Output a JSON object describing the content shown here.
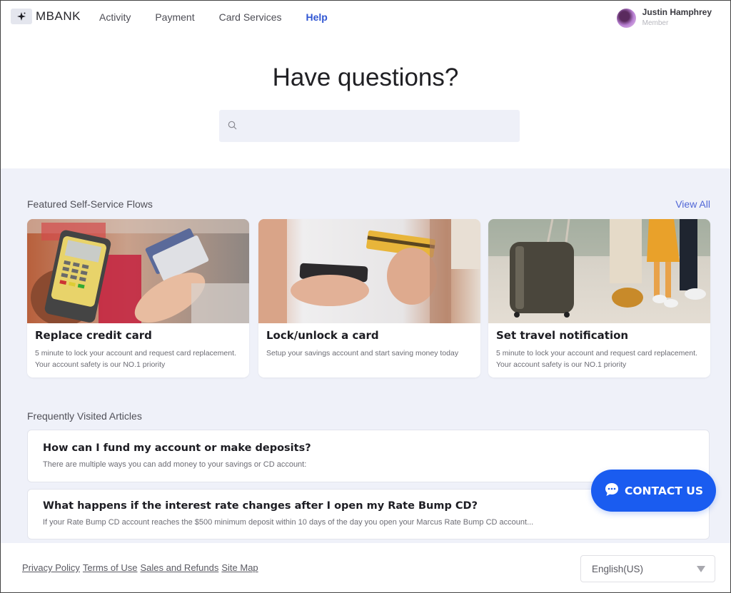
{
  "header": {
    "brand": "MBANK",
    "nav": [
      {
        "label": "Activity",
        "active": false
      },
      {
        "label": "Payment",
        "active": false
      },
      {
        "label": "Card Services",
        "active": false
      },
      {
        "label": "Help",
        "active": true
      }
    ],
    "user": {
      "name": "Justin Hamphrey",
      "role": "Member"
    }
  },
  "hero": {
    "title": "Have questions?",
    "search": {
      "value": "",
      "placeholder": "",
      "icon": "search-icon"
    }
  },
  "featured": {
    "title": "Featured Self-Service Flows",
    "view_all": "View All",
    "cards": [
      {
        "title": "Replace credit card",
        "description": "5 minute to lock your account and request card replacement. Your account safety is our NO.1 priority",
        "image": "card-payment-terminal-photo"
      },
      {
        "title": "Lock/unlock a card",
        "description": "Setup your savings account and start saving money today",
        "image": "phone-and-card-photo"
      },
      {
        "title": "Set travel notification",
        "description": "5 minute to lock your account and request card replacement. Your account safety is our NO.1 priority",
        "image": "travel-luggage-photo"
      }
    ]
  },
  "articles": {
    "title": "Frequently Visited Articles",
    "items": [
      {
        "title": "How can I fund my account or make deposits?",
        "description": "There are multiple ways you can add money to your savings or CD account:"
      },
      {
        "title": "What happens if the interest rate changes after I open my Rate Bump CD?",
        "description": "If your Rate Bump CD account reaches the $500 minimum deposit within 10 days of the day you open your Marcus Rate Bump CD account..."
      }
    ]
  },
  "contact": {
    "label": "CONTACT US",
    "icon": "chat-bubble-icon",
    "color": "#1a5cf0"
  },
  "footer": {
    "links": [
      "Privacy Policy",
      "Terms of Use",
      "Sales and Refunds",
      "Site Map"
    ],
    "language": "English(US)"
  },
  "colors": {
    "accent": "#3056d3",
    "section_bg": "#eff1f9",
    "button": "#1a5cf0"
  }
}
